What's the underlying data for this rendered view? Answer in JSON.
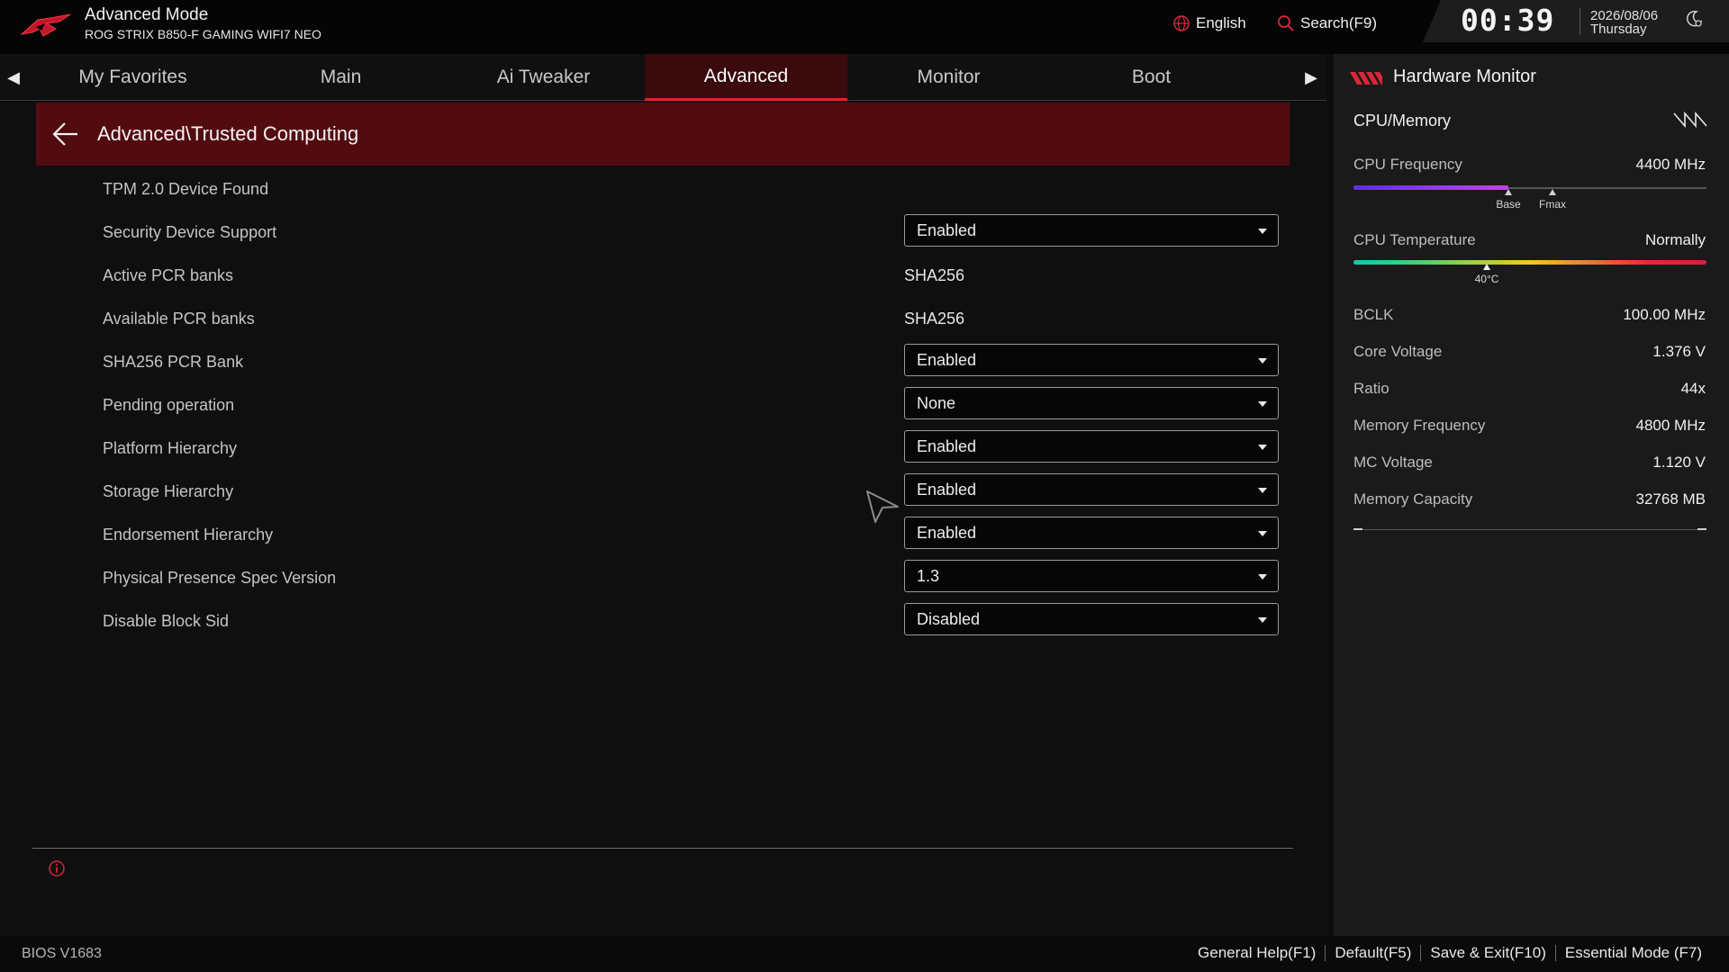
{
  "header": {
    "mode_title": "Advanced Mode",
    "board_name": "ROG STRIX B850-F GAMING WIFI7 NEO",
    "language": "English",
    "search": "Search(F9)",
    "clock": "00:39",
    "date": "2026/08/06",
    "day": "Thursday"
  },
  "tabs": [
    {
      "label": "My Favorites"
    },
    {
      "label": "Main"
    },
    {
      "label": "Ai Tweaker"
    },
    {
      "label": "Advanced"
    },
    {
      "label": "Monitor"
    },
    {
      "label": "Boot"
    }
  ],
  "active_tab": "Advanced",
  "breadcrumb": "Advanced\\Trusted Computing",
  "settings": [
    {
      "label": "TPM 2.0 Device Found"
    },
    {
      "label": "Security Device Support",
      "dropdown": "Enabled"
    },
    {
      "label": "Active PCR banks",
      "value": "SHA256"
    },
    {
      "label": "Available PCR banks",
      "value": "SHA256"
    },
    {
      "label": "SHA256 PCR Bank",
      "dropdown": "Enabled"
    },
    {
      "label": "Pending operation",
      "dropdown": "None"
    },
    {
      "label": "Platform Hierarchy",
      "dropdown": "Enabled"
    },
    {
      "label": "Storage Hierarchy",
      "dropdown": "Enabled"
    },
    {
      "label": "Endorsement Hierarchy",
      "dropdown": "Enabled"
    },
    {
      "label": "Physical Presence Spec Version",
      "dropdown": "1.3"
    },
    {
      "label": "Disable Block Sid",
      "dropdown": "Disabled"
    }
  ],
  "hardware_monitor": {
    "title": "Hardware Monitor",
    "section": "CPU/Memory",
    "cpu_frequency": {
      "label": "CPU Frequency",
      "value": "4400 MHz",
      "fill_fraction": 0.44,
      "base_label": "Base",
      "fmax_label": "Fmax"
    },
    "cpu_temperature": {
      "label": "CPU Temperature",
      "value": "Normally",
      "marker_label": "40°C"
    },
    "bclk": {
      "label": "BCLK",
      "value": "100.00 MHz"
    },
    "core_voltage": {
      "label": "Core Voltage",
      "value": "1.376 V"
    },
    "ratio": {
      "label": "Ratio",
      "value": "44x"
    },
    "memory_frequency": {
      "label": "Memory Frequency",
      "value": "4800 MHz"
    },
    "mc_voltage": {
      "label": "MC Voltage",
      "value": "1.120 V"
    },
    "memory_capacity": {
      "label": "Memory Capacity",
      "value": "32768 MB"
    }
  },
  "footer": {
    "bios_version": "BIOS V1683",
    "general_help": "General Help(F1)",
    "default": "Default(F5)",
    "save_exit": "Save & Exit(F10)",
    "essential_mode": "Essential Mode (F7)"
  },
  "colors": {
    "accent_red": "#e0242e",
    "breadcrumb_bg": "#520c10",
    "active_tab_bg": "#3a0a0c"
  }
}
